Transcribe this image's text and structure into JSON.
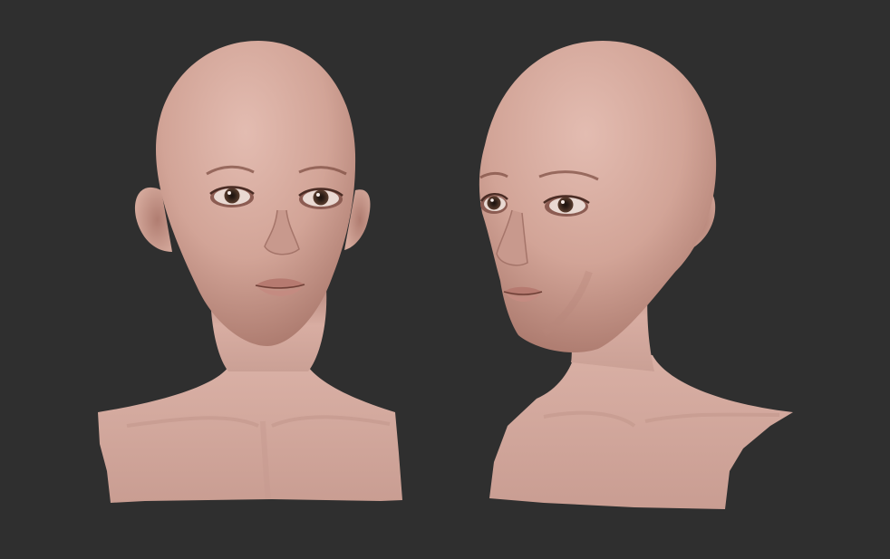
{
  "scene": {
    "background_color": "#2f2f2f",
    "skin_color": "#d6aba0",
    "skin_shadow_color": "#a7766b",
    "iris_color": "#3b2a22",
    "views": [
      {
        "name": "front-view",
        "subject": "head-bust"
      },
      {
        "name": "three-quarter-view",
        "subject": "head-bust"
      }
    ]
  }
}
